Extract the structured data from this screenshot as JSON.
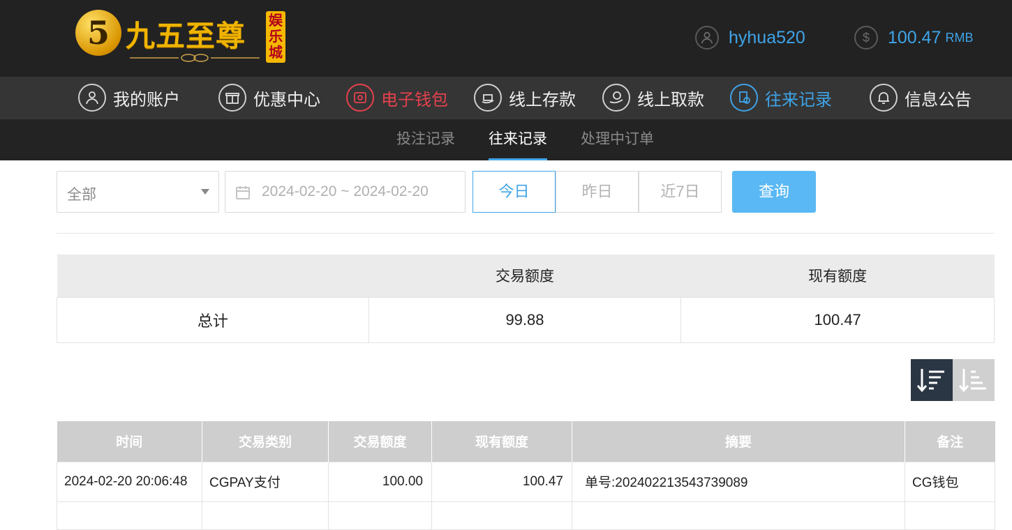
{
  "brand": {
    "badge": "5",
    "name": "九五至尊",
    "tag": [
      "娱",
      "乐",
      "城"
    ],
    "gold": "#f0b400"
  },
  "account": {
    "username": "hyhua520",
    "balance": "100.47",
    "currency": "RMB",
    "user_icon": "user-icon",
    "balance_icon": "dollar-icon"
  },
  "nav": [
    {
      "label": "我的账户",
      "icon": "user-icon"
    },
    {
      "label": "优惠中心",
      "icon": "gift-icon"
    },
    {
      "label": "电子钱包",
      "icon": "wallet-icon",
      "color": "#e5414d"
    },
    {
      "label": "线上存款",
      "icon": "deposit-icon"
    },
    {
      "label": "线上取款",
      "icon": "withdraw-icon"
    },
    {
      "label": "往来记录",
      "icon": "records-icon",
      "color": "#3fa4e8"
    },
    {
      "label": "信息公告",
      "icon": "bell-icon"
    }
  ],
  "subnav": [
    {
      "label": "投注记录"
    },
    {
      "label": "往来记录",
      "active": true
    },
    {
      "label": "处理中订单"
    }
  ],
  "filter": {
    "type_selected": "全部",
    "date_range": "2024-02-20 ~ 2024-02-20",
    "quick": [
      "今日",
      "昨日",
      "近7日"
    ],
    "quick_active": "今日",
    "query": "查询"
  },
  "summary": {
    "headers": [
      "",
      "交易额度",
      "现有额度"
    ],
    "row": {
      "label": "总计",
      "amount": "99.88",
      "balance": "100.47"
    }
  },
  "records": {
    "headers": [
      "时间",
      "交易类别",
      "交易额度",
      "现有额度",
      "摘要",
      "备注"
    ],
    "rows": [
      {
        "time": "2024-02-20 20:06:48",
        "type": "CGPAY支付",
        "amount": "100.00",
        "balance": "100.47",
        "summary": "单号:202402213543739089",
        "note": "CG钱包"
      }
    ]
  },
  "colors": {
    "accent": "#3fa4e8",
    "alert": "#e5414d",
    "header_bg": "#222222",
    "query_button": "#5ab8f4"
  }
}
